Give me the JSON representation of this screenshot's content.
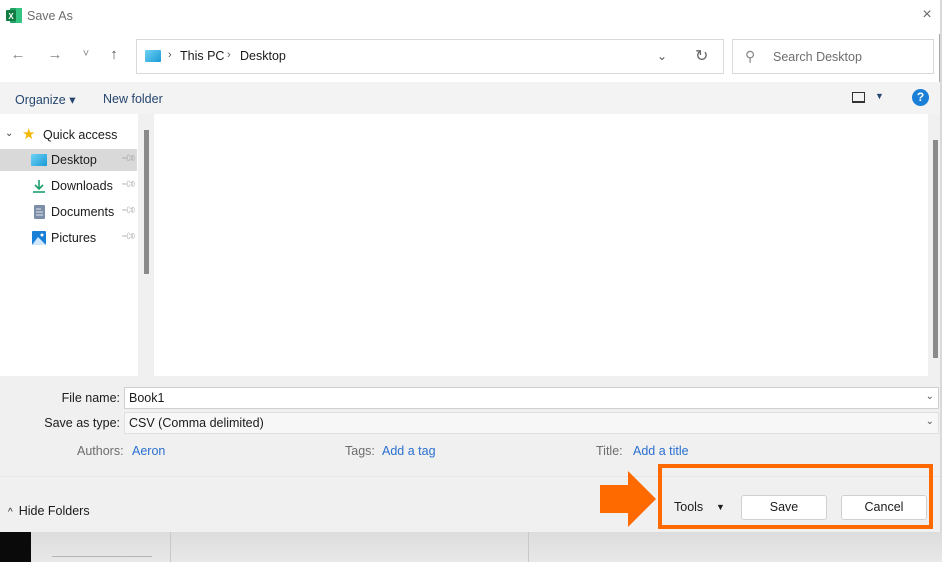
{
  "window": {
    "title": "Save As",
    "close_label": "×"
  },
  "nav": {
    "back_icon": "←",
    "forward_icon": "→",
    "recent_icon": "˅",
    "up_icon": "↑",
    "breadcrumb": [
      "This PC",
      "Desktop"
    ],
    "search_placeholder": "Search Desktop"
  },
  "toolbar": {
    "organize_label": "Organize ▾",
    "new_folder_label": "New folder",
    "help_label": "?"
  },
  "sidebar": {
    "quick_access_label": "Quick access",
    "items": [
      {
        "label": "Desktop",
        "icon": "desktop-icon",
        "selected": true,
        "pinned": true
      },
      {
        "label": "Downloads",
        "icon": "downloads-icon",
        "selected": false,
        "pinned": true
      },
      {
        "label": "Documents",
        "icon": "documents-icon",
        "selected": false,
        "pinned": true
      },
      {
        "label": "Pictures",
        "icon": "pictures-icon",
        "selected": false,
        "pinned": true
      }
    ]
  },
  "form": {
    "file_name_label": "File name:",
    "file_name_value": "Book1",
    "save_type_label": "Save as type:",
    "save_type_value": "CSV (Comma delimited)",
    "authors_label": "Authors:",
    "authors_value": "Aeron",
    "tags_label": "Tags:",
    "tags_value": "Add a tag",
    "title_label": "Title:",
    "title_value": "Add a title"
  },
  "footer": {
    "hide_folders_label": "Hide Folders",
    "tools_label": "Tools",
    "save_label": "Save",
    "cancel_label": "Cancel"
  },
  "annotation": {
    "highlight_color": "#ff6a00"
  }
}
